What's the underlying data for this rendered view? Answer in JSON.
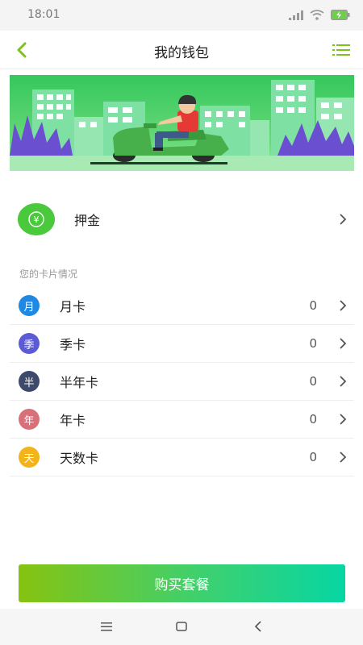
{
  "status_bar": {
    "time": "18:01"
  },
  "header": {
    "title": "我的钱包"
  },
  "deposit": {
    "icon_symbol": "¥",
    "label": "押金"
  },
  "cards_section": {
    "label": "您的卡片情况",
    "items": [
      {
        "badge": "月",
        "name": "月卡",
        "count": "0",
        "color": "#1e88e5"
      },
      {
        "badge": "季",
        "name": "季卡",
        "count": "0",
        "color": "#5b5bd6"
      },
      {
        "badge": "半",
        "name": "半年卡",
        "count": "0",
        "color": "#3e4a6b"
      },
      {
        "badge": "年",
        "name": "年卡",
        "count": "0",
        "color": "#d8707a"
      },
      {
        "badge": "天",
        "name": "天数卡",
        "count": "0",
        "color": "#f2b31b"
      }
    ]
  },
  "buy_button": {
    "label": "购买套餐"
  },
  "colors": {
    "accent_green": "#7dc11f",
    "deposit_green": "#49c93b"
  },
  "icons": [
    "signal-icon",
    "wifi-icon",
    "battery-icon",
    "back-icon",
    "menu-list-icon",
    "yuan-icon",
    "chevron-right-icon",
    "nav-menu-icon",
    "nav-home-icon",
    "nav-back-icon"
  ]
}
